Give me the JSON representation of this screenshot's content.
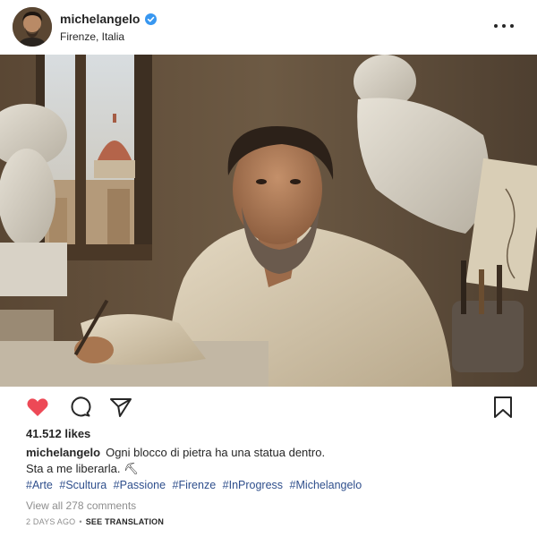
{
  "header": {
    "username": "michelangelo",
    "location": "Firenze, Italia",
    "verified_color": "#3897f0",
    "more_icon": "more-horizontal-icon"
  },
  "actions": {
    "like_icon": "heart-filled-icon",
    "like_color": "#ed4956",
    "comment_icon": "comment-icon",
    "share_icon": "send-icon",
    "save_icon": "bookmark-icon"
  },
  "likes": "41.512 likes",
  "caption": {
    "username": "michelangelo",
    "line1": "Ogni blocco di pietra ha una statua dentro.",
    "line2": "Sta a me liberarla. ⛏"
  },
  "hashtags": [
    "#Arte",
    "#Scultura",
    "#Passione",
    "#Firenze",
    "#InProgress",
    "#Michelangelo"
  ],
  "comments_link": "View all 278 comments",
  "meta": {
    "time": "2 DAYS AGO",
    "separator": "•",
    "translate": "SEE TRANSLATION"
  }
}
